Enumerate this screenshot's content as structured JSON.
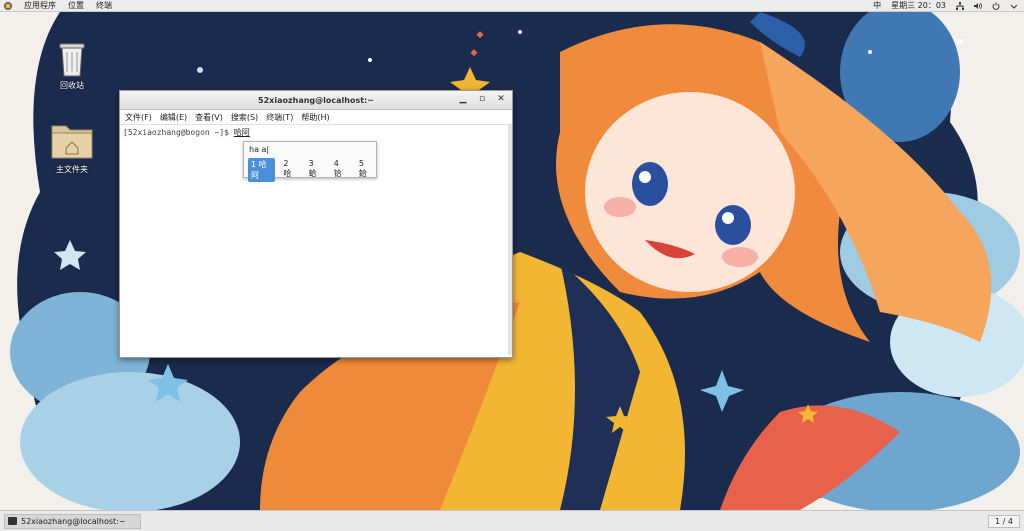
{
  "topbar": {
    "menu": [
      "应用程序",
      "位置",
      "终端"
    ],
    "input_method": "中",
    "clock": "星期三 20：03"
  },
  "desktop": {
    "icons": [
      {
        "label": "回收站",
        "icon": "trash-icon"
      },
      {
        "label": "主文件夹",
        "icon": "home-folder-icon"
      }
    ]
  },
  "terminal": {
    "title": "52xiaozhang@localhost:~",
    "menu": [
      "文件(F)",
      "编辑(E)",
      "查看(V)",
      "搜索(S)",
      "终端(T)",
      "帮助(H)"
    ],
    "prompt": "[52xiaozhang@bogon ~]$ ",
    "preedit": "哈阿"
  },
  "ime": {
    "pinyin": "ha a|",
    "candidates": [
      "1 哈阿",
      "2 哈",
      "3 蛤",
      "4 铪",
      "5 鉿"
    ]
  },
  "taskbar": {
    "window_label": "52xiaozhang@localhost:~",
    "pager": "1 / 4"
  }
}
